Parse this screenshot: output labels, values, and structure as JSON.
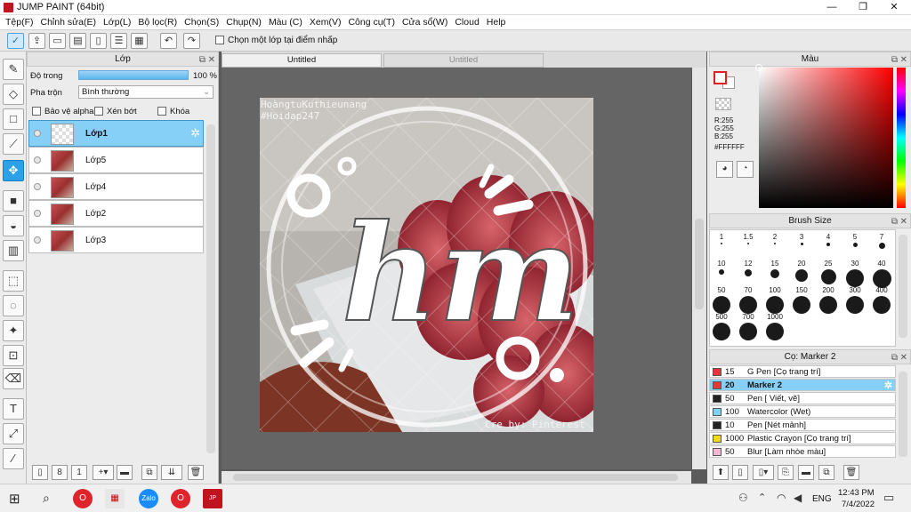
{
  "app": {
    "title": "JUMP PAINT (64bit)",
    "minimize": "—",
    "maximize": "❐",
    "close": "✕"
  },
  "menu": [
    "Tệp(F)",
    "Chỉnh sửa(E)",
    "Lớp(L)",
    "Bộ lọc(R)",
    "Chọn(S)",
    "Chụp(N)",
    "Màu (C)",
    "Xem(V)",
    "Công cụ(T)",
    "Cửa sổ(W)",
    "Cloud",
    "Help"
  ],
  "toolbar": {
    "checkbox_label": "Chọn một lớp tại điểm nhấp",
    "checked": false
  },
  "layers_panel": {
    "title": "Lớp",
    "opacity_label": "Độ trong",
    "opacity_value": "100 %",
    "opacity_percent": 100,
    "blend_label": "Pha trộn",
    "blend_value": "Bình thường",
    "protect_alpha": "Bảo vệ alpha",
    "clip": "Xén bớt",
    "lock": "Khóa",
    "layers": [
      {
        "name": "Lớp1",
        "selected": true,
        "blank": true
      },
      {
        "name": "Lớp5",
        "selected": false,
        "blank": false
      },
      {
        "name": "Lớp4",
        "selected": false,
        "blank": false
      },
      {
        "name": "Lớp2",
        "selected": false,
        "blank": false
      },
      {
        "name": "Lớp3",
        "selected": false,
        "blank": false
      }
    ]
  },
  "tabs": [
    {
      "label": "Untitled",
      "active": true
    },
    {
      "label": "Untitled",
      "active": false
    }
  ],
  "artwork": {
    "watermark_line1": "HoàngtuKuthieunang",
    "watermark_line2": "#Hoidap247",
    "lettering": "hm",
    "credit": "Cre by: Pinterest"
  },
  "color_panel": {
    "title": "Màu",
    "r": "R:255",
    "g": "G:255",
    "b": "B:255",
    "hex": "#FFFFFF"
  },
  "brush_size": {
    "title": "Brush Size",
    "sizes": [
      "1",
      "1.5",
      "2",
      "3",
      "4",
      "5",
      "7",
      "10",
      "12",
      "15",
      "20",
      "25",
      "30",
      "40",
      "50",
      "70",
      "100",
      "150",
      "200",
      "300",
      "400",
      "500",
      "700",
      "1000"
    ]
  },
  "brush_list": {
    "title": "Cọ: Marker 2",
    "items": [
      {
        "size": "15",
        "name": "G Pen [Cọ trang trí]",
        "color": "#e8333a"
      },
      {
        "size": "20",
        "name": "Marker 2",
        "color": "#e8333a",
        "selected": true
      },
      {
        "size": "50",
        "name": "Pen [ Viết, vẽ]",
        "color": "#222222"
      },
      {
        "size": "100",
        "name": "Watercolor (Wet)",
        "color": "#7fd3f0"
      },
      {
        "size": "10",
        "name": "Pen [Nét mảnh]",
        "color": "#222222"
      },
      {
        "size": "1000",
        "name": "Plastic Crayon [Cọ trang trí]",
        "color": "#f0d81a"
      },
      {
        "size": "50",
        "name": "Blur [Làm nhòe màu]",
        "color": "#f2b8d6"
      }
    ]
  },
  "taskbar": {
    "lang": "ENG",
    "time": "12:43 PM",
    "date": "7/4/2022"
  }
}
